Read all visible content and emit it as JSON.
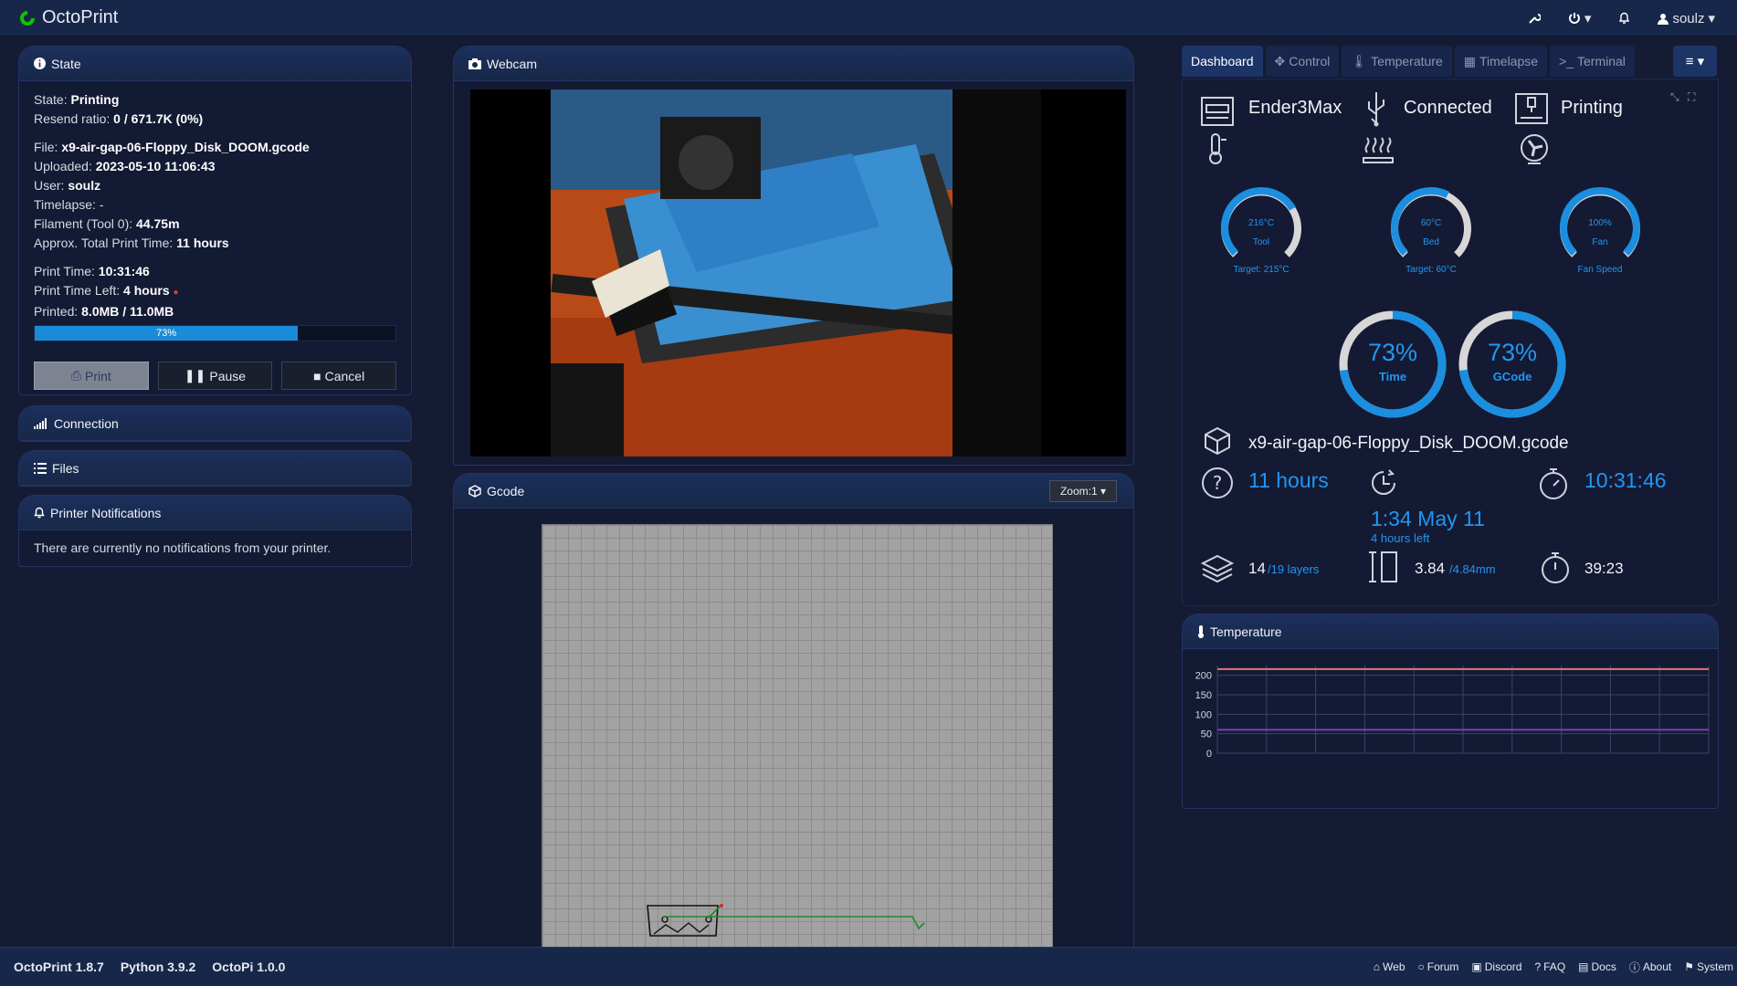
{
  "header": {
    "brand": "OctoPrint",
    "user": "soulz"
  },
  "state_panel": {
    "title": "State",
    "state_label": "State:",
    "state_value": "Printing",
    "resend_label": "Resend ratio:",
    "resend_value": "0 / 671.7K (0%)",
    "file_label": "File:",
    "file_value": "x9-air-gap-06-Floppy_Disk_DOOM.gcode",
    "uploaded_label": "Uploaded:",
    "uploaded_value": "2023-05-10 11:06:43",
    "user_label": "User:",
    "user_value": "soulz",
    "timelapse_label": "Timelapse:",
    "timelapse_value": "-",
    "filament_label": "Filament (Tool 0):",
    "filament_value": "44.75m",
    "approx_label": "Approx. Total Print Time:",
    "approx_value": "11 hours",
    "print_time_label": "Print Time:",
    "print_time_value": "10:31:46",
    "time_left_label": "Print Time Left:",
    "time_left_value": "4 hours",
    "printed_label": "Printed:",
    "printed_value": "8.0MB / 11.0MB",
    "progress_label": "73%",
    "progress_fraction": 0.73,
    "print_btn": "Print",
    "pause_btn": "Pause",
    "cancel_btn": "Cancel"
  },
  "connection_panel": {
    "title": "Connection"
  },
  "files_panel": {
    "title": "Files"
  },
  "notifications_panel": {
    "title": "Printer Notifications",
    "message": "There are currently no notifications from your printer."
  },
  "webcam_panel": {
    "title": "Webcam"
  },
  "gcode_panel": {
    "title": "Gcode",
    "zoom": "Zoom:1"
  },
  "tabs": [
    {
      "label": "Dashboard",
      "icon": "dashboard"
    },
    {
      "label": "Control",
      "icon": "arrows-icon"
    },
    {
      "label": "Temperature",
      "icon": "thermometer-icon"
    },
    {
      "label": "Timelapse",
      "icon": "film-icon"
    },
    {
      "label": "Terminal",
      "icon": "terminal-icon"
    }
  ],
  "dashboard": {
    "printer_name": "Ender3Max",
    "connection_status": "Connected",
    "print_status": "Printing",
    "gauges": [
      {
        "value": "216°C",
        "label": "Tool",
        "target": "Target: 215°C",
        "fraction": 0.72
      },
      {
        "value": "60°C",
        "label": "Bed",
        "target": "Target: 60°C",
        "fraction": 0.6
      },
      {
        "value": "100%",
        "label": "Fan",
        "target": "Fan Speed",
        "fraction": 1.0
      }
    ],
    "progress_rings": [
      {
        "value": "73%",
        "label": "Time",
        "fraction": 0.73
      },
      {
        "value": "73%",
        "label": "GCode",
        "fraction": 0.73
      }
    ],
    "filename": "x9-air-gap-06-Floppy_Disk_DOOM.gcode",
    "est_total": "11 hours",
    "eta_time": "1:34 May 11",
    "eta_left": "4 hours left",
    "elapsed": "10:31:46",
    "layer_current": "14",
    "layer_total": "/19 layers",
    "height_current": "3.84",
    "height_total": "/4.84mm",
    "layer_time": "39:23"
  },
  "temperature_panel": {
    "title": "Temperature"
  },
  "chart_data": {
    "type": "line",
    "title": "",
    "xlabel": "",
    "ylabel": "",
    "yticks": [
      "200",
      "150",
      "100",
      "50",
      "0"
    ],
    "ylim": [
      0,
      225
    ],
    "x": [
      0,
      1,
      2,
      3,
      4,
      5,
      6,
      7,
      8,
      9,
      10
    ],
    "series": [
      {
        "values": [
          216,
          216,
          216,
          216,
          216,
          216,
          216,
          216,
          216,
          216,
          216
        ],
        "color": "#e57373"
      },
      {
        "values": [
          60,
          60,
          60,
          60,
          60,
          60,
          60,
          60,
          60,
          60,
          60
        ],
        "color": "#7b3fbf"
      }
    ],
    "grid": true
  },
  "footer": {
    "version_octoprint": "OctoPrint 1.8.7",
    "version_python": "Python 3.9.2",
    "version_octopi": "OctoPi 1.0.0",
    "links": [
      "Web",
      "Forum",
      "Discord",
      "FAQ",
      "Docs",
      "About",
      "System"
    ]
  },
  "colors": {
    "accent": "#2196f3",
    "panel_bg": "#131a33",
    "header_bg": "#16274a"
  }
}
